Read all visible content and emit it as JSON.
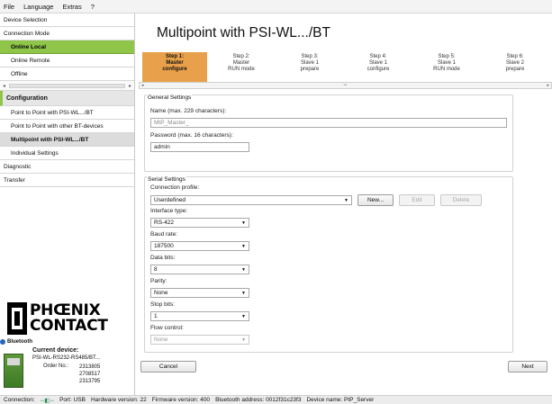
{
  "menu": [
    "File",
    "Language",
    "Extras",
    "?"
  ],
  "sidebar": {
    "device_selection": "Device Selection",
    "connection_mode": "Connection Mode",
    "online_local": "Online Local",
    "online_remote": "Online Remote",
    "offline": "Offline",
    "configuration": "Configuration",
    "point_to_point": "Point to Point with PSI-WL.../BT",
    "point_to_point_other": "Point to Point with other BT-devices",
    "multipoint": "Multipoint with PSI-WL.../BT",
    "individual_settings": "Individual Settings",
    "diagnostic": "Diagnostic",
    "transfer": "Transfer"
  },
  "logo": {
    "line1": "PHŒNIX",
    "line2": "CONTACT"
  },
  "device": {
    "bluetooth_label": "Bluetooth",
    "current_device": "Current device:",
    "name": "PSI-WL-RS232-RS485/BT...",
    "order_label": "Order No.:",
    "order_numbers": [
      "2313805",
      "2708517",
      "2313795"
    ]
  },
  "main": {
    "title": "Multipoint with PSI-WL.../BT",
    "steps": [
      {
        "l1": "Step 1:",
        "l2": "Master",
        "l3": "configure"
      },
      {
        "l1": "Step 2:",
        "l2": "Master",
        "l3": "RUN mode"
      },
      {
        "l1": "Step 3:",
        "l2": "Slave 1",
        "l3": "prepare"
      },
      {
        "l1": "Step 4:",
        "l2": "Slave 1",
        "l3": "configure"
      },
      {
        "l1": "Step 5:",
        "l2": "Slave 1",
        "l3": "RUN mode"
      },
      {
        "l1": "Step 6:",
        "l2": "Slave 2",
        "l3": "prepare"
      }
    ],
    "scroll_left": "◂",
    "scroll_mid": "═",
    "scroll_right": "▸",
    "general_settings": "General Settings",
    "name_label": "Name (max. 229 characters):",
    "name_value": "MtP_Master_",
    "password_label": "Password (max. 16 characters):",
    "password_value": "admin",
    "serial_settings": "Serial Settings",
    "connection_profile_label": "Connection profile:",
    "connection_profile_value": "Userdefined",
    "new_button": "New...",
    "edit_button": "Edit",
    "delete_button": "Delete",
    "interface_type_label": "Interface type:",
    "interface_type_value": "RS-422",
    "baud_rate_label": "Baud rate:",
    "baud_rate_value": "187500",
    "data_bits_label": "Data bits:",
    "data_bits_value": "8",
    "parity_label": "Parity:",
    "parity_value": "None",
    "stop_bits_label": "Stop bits:",
    "stop_bits_value": "1",
    "flow_control_label": "Flow control:",
    "flow_control_value": "None",
    "cancel_button": "Cancel",
    "next_button": "Next"
  },
  "status": {
    "connection": "Connection:",
    "port": "Port:  USB",
    "hardware": "Hardware version:  22",
    "firmware": "Firmware version:  400",
    "bt_address": "Bluetooth address:  0012f31c23f3",
    "device_name": "Device name:  PtP_Server"
  },
  "colors": {
    "accent_green": "#8fc64a",
    "step_active": "#e8a14a"
  }
}
